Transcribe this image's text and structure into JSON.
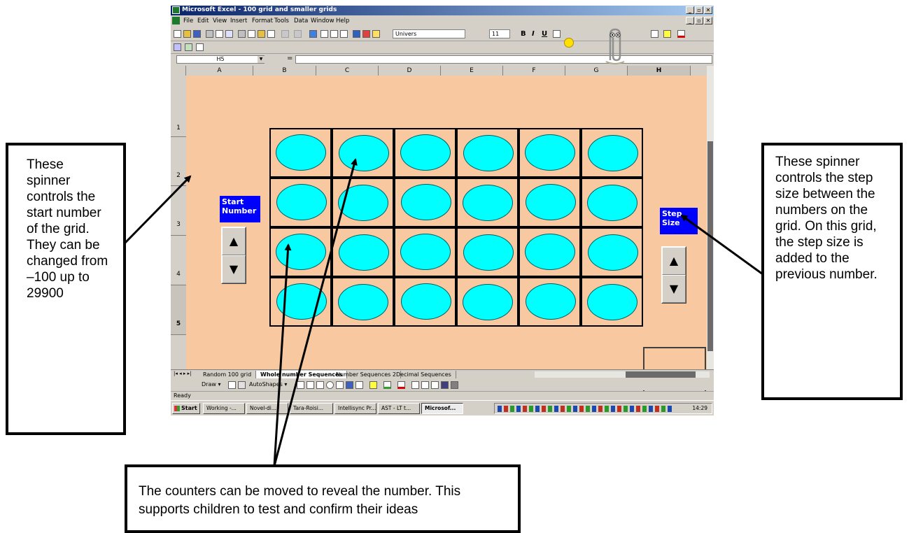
{
  "window": {
    "title": "Microsoft Excel - 100 grid and smaller grids",
    "buttons": [
      "_",
      "▫",
      "✕"
    ]
  },
  "menubar": {
    "items": [
      "File",
      "Edit",
      "View",
      "Insert",
      "Format",
      "Tools",
      "Data",
      "Window",
      "Help"
    ]
  },
  "toolbar": {
    "font_name": "Univers",
    "font_size": "11",
    "bold": "B",
    "italic": "I",
    "underline": "U"
  },
  "formula_bar": {
    "name_box": "H5",
    "equals": "="
  },
  "columns": [
    "A",
    "B",
    "C",
    "D",
    "E",
    "F",
    "G",
    "H"
  ],
  "rows": [
    "1",
    "2",
    "3",
    "4",
    "5"
  ],
  "controls": {
    "start_label": "Start Number",
    "step_label": "Step Size",
    "up_glyph": "▲",
    "down_glyph": "▼"
  },
  "grid": {
    "rows": 4,
    "columns": 6
  },
  "sheet_tabs": {
    "nav": "|◂ ◂ ▸ ▸|",
    "tabs": [
      "Random 100 grid",
      "Whole number Sequences",
      "Number Sequences 2",
      "Decimal Sequences"
    ],
    "active": "Whole number Sequences"
  },
  "draw_toolbar": {
    "draw": "Draw ▾",
    "autoshapes": "AutoShapes ▾"
  },
  "status_bar": {
    "text": "Ready"
  },
  "taskbar": {
    "start": "Start",
    "buttons": [
      "Working -...",
      "Novel-di...",
      "Tara-Roisi...",
      "Intellisync Pr...",
      "AST - LT t...",
      "Microsof..."
    ],
    "active": "Microsof...",
    "clock": "14:29"
  },
  "callouts": {
    "left": "These spinner controls the start number of the grid. They can be changed from –100 up to 29900",
    "right": "These spinner controls the step size between the numbers on the grid. On this grid, the step size is added to the previous number.",
    "bottom": "The counters can be moved to reveal the number. This supports children to test and confirm their ideas"
  }
}
